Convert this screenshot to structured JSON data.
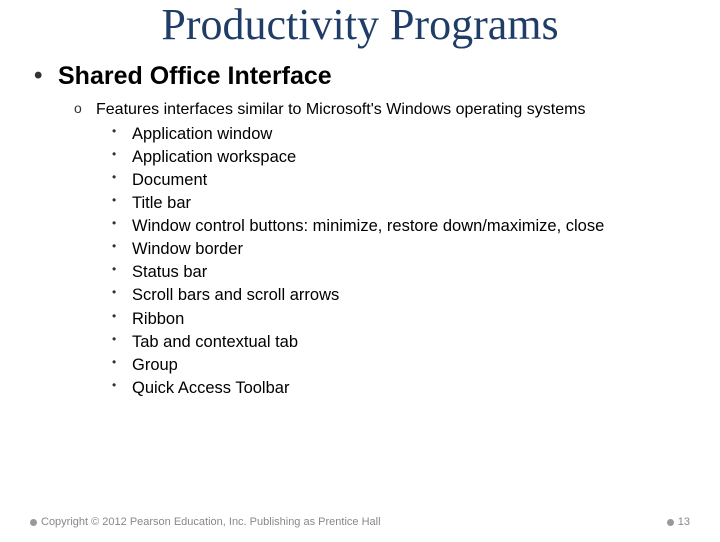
{
  "title": "Productivity Programs",
  "heading": "Shared Office Interface",
  "subheading": "Features interfaces similar to Microsoft's Windows operating systems",
  "items": [
    "Application window",
    "Application workspace",
    "Document",
    "Title bar",
    "Window control buttons: minimize, restore down/maximize, close",
    "Window border",
    "Status bar",
    "Scroll bars and scroll arrows",
    "Ribbon",
    "Tab and contextual tab",
    "Group",
    "Quick Access Toolbar"
  ],
  "footer": {
    "copyright": "Copyright © 2012 Pearson Education, Inc. Publishing as Prentice Hall",
    "page": "13"
  }
}
